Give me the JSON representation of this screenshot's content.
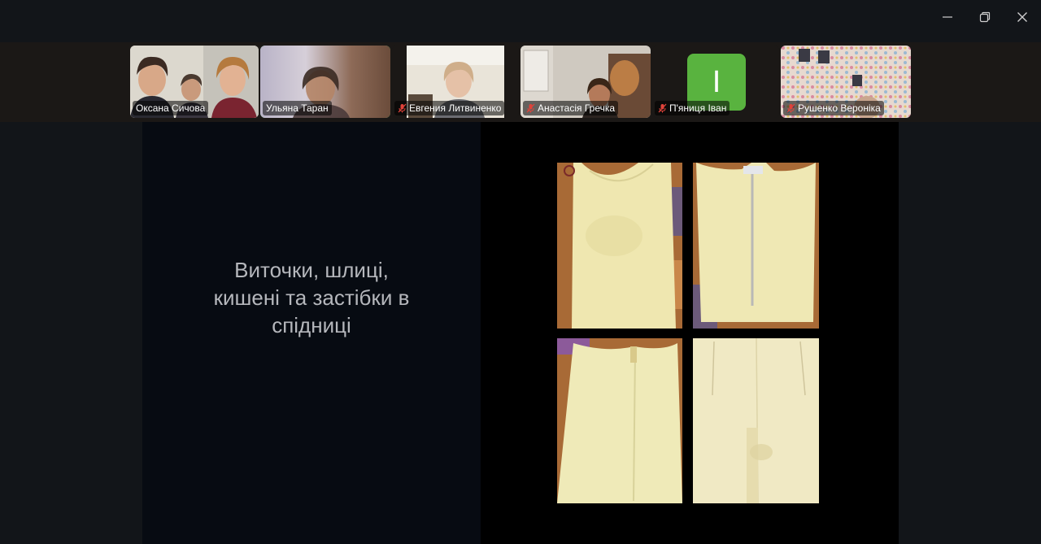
{
  "window": {
    "controls": [
      "minimize-icon",
      "restore-icon",
      "close-icon"
    ]
  },
  "participants": [
    {
      "name": "Оксана Сичова",
      "muted": false,
      "active": false
    },
    {
      "name": "Ульяна Таран",
      "muted": false,
      "active": true
    },
    {
      "name": "Евгения Литвиненко",
      "muted": true,
      "active": false
    },
    {
      "name": "Анастасія Гречка",
      "muted": true,
      "active": false
    },
    {
      "name": "П'яниця Іван",
      "muted": true,
      "active": false,
      "avatar_letter": "I",
      "avatar_color": "#59b33f"
    },
    {
      "name": "Рушенко Вероніка",
      "muted": true,
      "active": false
    }
  ],
  "slide": {
    "title_lines": [
      "Виточки, шлиці,",
      "кишені та застібки в",
      "спідниці"
    ]
  },
  "colors": {
    "active_border": "#3fd37a",
    "muted_mic": "#e0433a"
  }
}
